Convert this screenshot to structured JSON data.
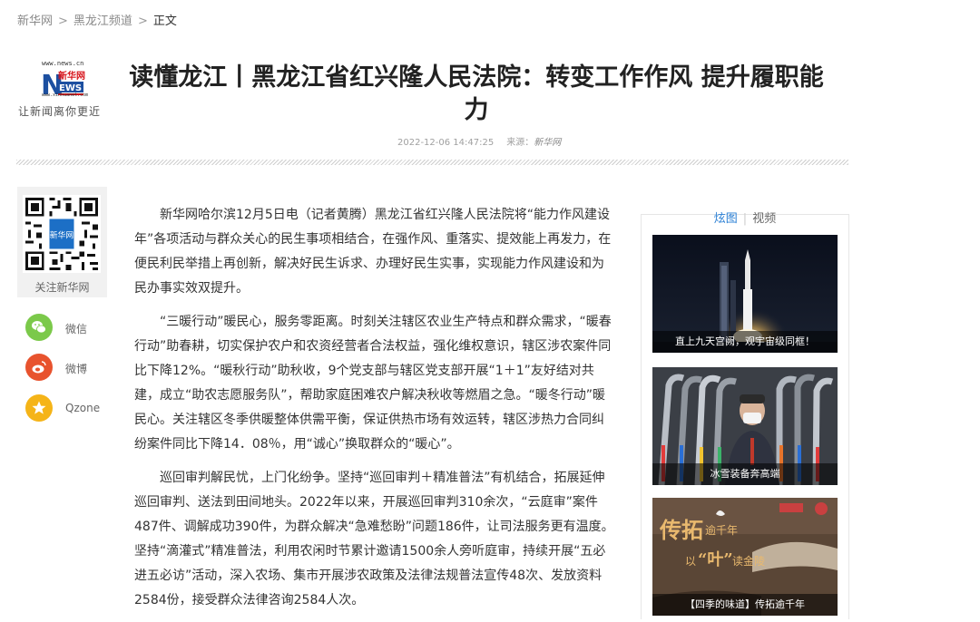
{
  "breadcrumb": {
    "home": "新华网",
    "channel": "黑龙江频道",
    "current": "正文",
    "sep": ">"
  },
  "logo": {
    "url_top": "www.news.cn",
    "url_bottom": "www.xinhuanet.com",
    "brand_cn": "新华网",
    "slogan": "让新闻离你更近"
  },
  "article": {
    "title": "读懂龙江丨黑龙江省红兴隆人民法院：转变工作作风 提升履职能力",
    "datetime": "2022-12-06 14:47:25",
    "source_label": "来源：",
    "source": "新华网",
    "paragraphs": [
      "新华网哈尔滨12月5日电（记者黄腾）黑龙江省红兴隆人民法院将“能力作风建设年”各项活动与群众关心的民生事项相结合，在强作风、重落实、提效能上再发力，在便民利民举措上再创新，解决好民生诉求、办理好民生实事，实现能力作风建设和为民办事实效双提升。",
      "“三暖行动”暖民心，服务零距离。时刻关注辖区农业生产特点和群众需求，“暖春行动”助春耕，切实保护农户和农资经营者合法权益，强化维权意识，辖区涉农案件同比下降12%。“暖秋行动”助秋收，9个党支部与辖区党支部开展“1＋1”友好结对共建，成立“助农志愿服务队”，帮助家庭困难农户解决秋收等燃眉之急。“暖冬行动”暖民心。关注辖区冬季供暖整体供需平衡，保证供热市场有效运转，辖区涉热力合同纠纷案件同比下降14．08％，用“诚心”换取群众的“暖心”。",
      "巡回审判解民忧，上门化纷争。坚持“巡回审判＋精准普法”有机结合，拓展延伸巡回审判、送法到田间地头。2022年以来，开展巡回审判310余次，“云庭审”案件487件、调解成功390件，为群众解决“急难愁盼”问题186件，让司法服务更有温度。坚持“滴灌式”精准普法，利用农闲时节累计邀请1500余人旁听庭审，持续开展“五必进五必访”活动，深入农场、集市开展涉农政策及法律法规普法宣传48次、发放资料2584份，接受群众法律咨询2584人次。"
    ]
  },
  "follow": {
    "label": "关注新华网",
    "qr_center": "新华网"
  },
  "share": [
    {
      "name": "wechat",
      "label": "微信",
      "color": "#7bc94a"
    },
    {
      "name": "weibo",
      "label": "微博",
      "color": "#e8532e"
    },
    {
      "name": "qzone",
      "label": "Qzone",
      "color": "#f5b418"
    }
  ],
  "sidebar": {
    "tabs": [
      "炫图",
      "视频"
    ],
    "cards": [
      {
        "caption": "直上九天宫阙，观宇宙级同框！"
      },
      {
        "caption": "冰雪装备奔高端"
      },
      {
        "caption": "【四季的味道】传拓逾千年",
        "overlay_big": "传拓",
        "overlay_small": "逾千年",
        "overlay_line2a": "以",
        "overlay_line2b": "“叶”",
        "overlay_line2c": "读金陵"
      }
    ]
  },
  "colors": {
    "accent": "#2a7fd4",
    "logo_red": "#d7141b",
    "logo_blue": "#1c4fa0"
  }
}
